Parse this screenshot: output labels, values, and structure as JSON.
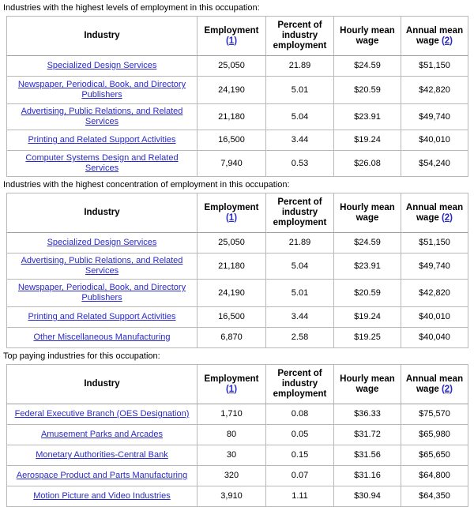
{
  "sections": [
    {
      "caption": "Industries with the highest levels of employment in this occupation:",
      "columns": {
        "industry": "Industry",
        "employment": "Employment",
        "employment_footnote": "(1)",
        "percent_line1": "Percent of",
        "percent_line2": "industry",
        "percent_line3": "employment",
        "hourly_line1": "Hourly mean",
        "hourly_line2": "wage",
        "annual_line1": "Annual mean",
        "annual_line2": "wage",
        "annual_footnote": "(2)"
      },
      "rows": [
        {
          "industry": "Specialized Design Services",
          "employment": "25,050",
          "percent": "21.89",
          "hourly": "$24.59",
          "annual": "$51,150"
        },
        {
          "industry": "Newspaper, Periodical, Book, and Directory Publishers",
          "employment": "24,190",
          "percent": "5.01",
          "hourly": "$20.59",
          "annual": "$42,820"
        },
        {
          "industry": "Advertising, Public Relations, and Related Services",
          "employment": "21,180",
          "percent": "5.04",
          "hourly": "$23.91",
          "annual": "$49,740"
        },
        {
          "industry": "Printing and Related Support Activities",
          "employment": "16,500",
          "percent": "3.44",
          "hourly": "$19.24",
          "annual": "$40,010"
        },
        {
          "industry": "Computer Systems Design and Related Services",
          "employment": "7,940",
          "percent": "0.53",
          "hourly": "$26.08",
          "annual": "$54,240"
        }
      ]
    },
    {
      "caption": "Industries with the highest concentration of employment in this occupation:",
      "columns": {
        "industry": "Industry",
        "employment": "Employment",
        "employment_footnote": "(1)",
        "percent_line1": "Percent of",
        "percent_line2": "industry",
        "percent_line3": "employment",
        "hourly_line1": "Hourly mean",
        "hourly_line2": "wage",
        "annual_line1": "Annual mean",
        "annual_line2": "wage",
        "annual_footnote": "(2)"
      },
      "rows": [
        {
          "industry": "Specialized Design Services",
          "employment": "25,050",
          "percent": "21.89",
          "hourly": "$24.59",
          "annual": "$51,150"
        },
        {
          "industry": "Advertising, Public Relations, and Related Services",
          "employment": "21,180",
          "percent": "5.04",
          "hourly": "$23.91",
          "annual": "$49,740"
        },
        {
          "industry": "Newspaper, Periodical, Book, and Directory Publishers",
          "employment": "24,190",
          "percent": "5.01",
          "hourly": "$20.59",
          "annual": "$42,820"
        },
        {
          "industry": "Printing and Related Support Activities",
          "employment": "16,500",
          "percent": "3.44",
          "hourly": "$19.24",
          "annual": "$40,010"
        },
        {
          "industry": "Other Miscellaneous Manufacturing",
          "employment": "6,870",
          "percent": "2.58",
          "hourly": "$19.25",
          "annual": "$40,040"
        }
      ]
    },
    {
      "caption": "Top paying industries for this occupation:",
      "columns": {
        "industry": "Industry",
        "employment": "Employment",
        "employment_footnote": "(1)",
        "percent_line1": "Percent of",
        "percent_line2": "industry",
        "percent_line3": "employment",
        "hourly_line1": "Hourly mean",
        "hourly_line2": "wage",
        "annual_line1": "Annual mean",
        "annual_line2": "wage",
        "annual_footnote": "(2)"
      },
      "rows": [
        {
          "industry": "Federal Executive Branch (OES Designation)",
          "employment": "1,710",
          "percent": "0.08",
          "hourly": "$36.33",
          "annual": "$75,570"
        },
        {
          "industry": "Amusement Parks and Arcades",
          "employment": "80",
          "percent": "0.05",
          "hourly": "$31.72",
          "annual": "$65,980"
        },
        {
          "industry": "Monetary Authorities-Central Bank",
          "employment": "30",
          "percent": "0.15",
          "hourly": "$31.56",
          "annual": "$65,650"
        },
        {
          "industry": "Aerospace Product and Parts Manufacturing",
          "employment": "320",
          "percent": "0.07",
          "hourly": "$31.16",
          "annual": "$64,800"
        },
        {
          "industry": "Motion Picture and Video Industries",
          "employment": "3,910",
          "percent": "1.11",
          "hourly": "$30.94",
          "annual": "$64,350"
        }
      ]
    }
  ],
  "colors": {
    "link": "#2929c9",
    "border": "#b8b8b8",
    "outer_border": "#a9a9a9",
    "text": "#000000",
    "background": "#ffffff"
  }
}
